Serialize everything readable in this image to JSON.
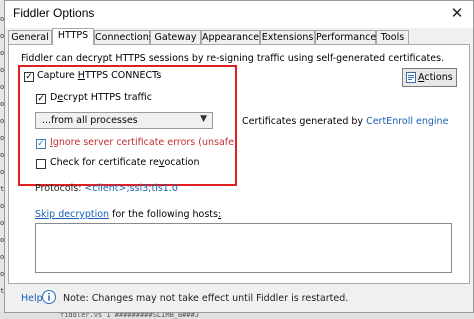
{
  "window": {
    "title": "Fiddler Options",
    "close_glyph": "✕"
  },
  "tabs": [
    {
      "label": "General"
    },
    {
      "label": "HTTPS"
    },
    {
      "label": "Connections"
    },
    {
      "label": "Gateway"
    },
    {
      "label": "Appearance"
    },
    {
      "label": "Extensions"
    },
    {
      "label": "Performance"
    },
    {
      "label": "Tools"
    }
  ],
  "active_tab": "HTTPS",
  "https": {
    "description": "Fiddler can decrypt HTTPS sessions by re-signing traffic using self-generated certificates.",
    "capture_connects": {
      "pre": "Capture ",
      "accel": "H",
      "post": "TTPS CONNECTs",
      "checked": true
    },
    "decrypt_traffic": {
      "pre": "D",
      "accel": "e",
      "post": "crypt HTTPS traffic",
      "checked": true
    },
    "process_filter": {
      "value": "...from all processes"
    },
    "ignore_errors": {
      "accel": "I",
      "post": "gnore server certificate errors (unsafe)",
      "checked": true
    },
    "check_revocation": {
      "pre": "Check for certificate re",
      "accel": "v",
      "post": "ocation",
      "checked": false
    },
    "actions_button": {
      "pre": "",
      "accel": "A",
      "post": "ctions"
    },
    "certs_generated": {
      "label": "Certificates generated by ",
      "engine_link": "CertEnroll engine"
    },
    "protocols": {
      "label": "Protocols: ",
      "value": "<client>;ssl3;tls1.0"
    },
    "skip_decryption": {
      "link": "Skip decryption",
      "post": " for the following hosts",
      "accel_tail": ":"
    },
    "hosts_value": ""
  },
  "footer": {
    "help_label": "Help",
    "note": "Note: Changes may not take effect until Fiddler is restarted."
  },
  "background": {
    "left_glyphs": [
      "oc",
      "oc",
      "oc",
      "oc",
      "oc",
      "oc",
      "oc",
      "oc",
      "oc",
      "oc",
      "t",
      "oc",
      "oc",
      "oc",
      "oc",
      "oc",
      "t"
    ],
    "bottom_text": "fiddler.vs  1   #########SLIMB_B###J"
  }
}
